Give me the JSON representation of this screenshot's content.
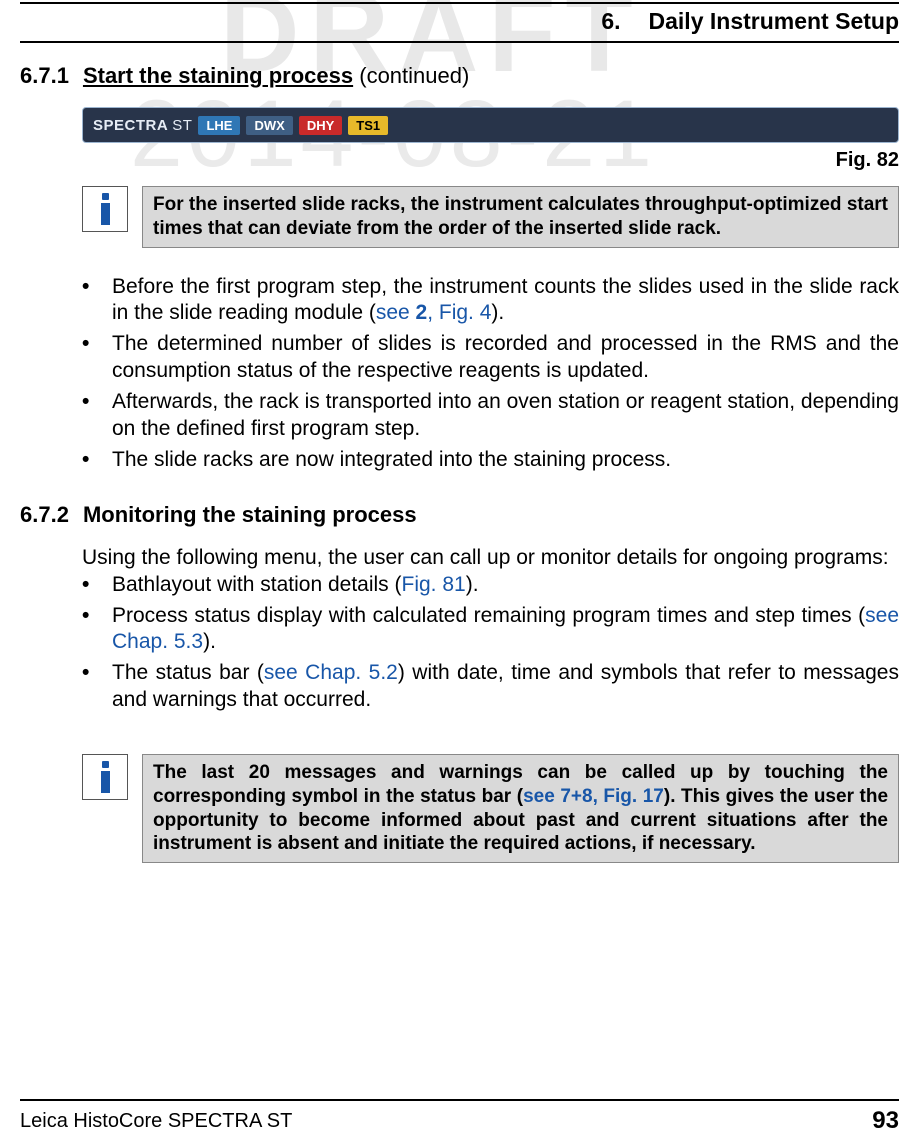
{
  "watermark": {
    "draft": "DRAFT",
    "date": "2014-08-21"
  },
  "chapter": {
    "number": "6.",
    "title": "Daily Instrument Setup"
  },
  "sec671": {
    "num": "6.7.1",
    "title": "Start the staining process",
    "suffix": " (continued)",
    "statusbar": {
      "brand_a": "SPECTRA",
      "brand_b": "ST",
      "tags": {
        "lhe": "LHE",
        "dwx": "DWX",
        "dhy": "DHY",
        "ts1": "TS1"
      }
    },
    "fig": "Fig. 82",
    "info": "For the inserted slide racks, the instrument calculates throughput-optimized start times that can deviate from the order of the inserted slide rack.",
    "bullets": {
      "b1a": "Before the first program step, the instrument counts the slides used in the slide rack in the slide reading module (",
      "b1_link1": "see ",
      "b1_bold": "2",
      "b1_link2": ", Fig. 4",
      "b1b": ").",
      "b2": "The determined number of slides is recorded and processed in the RMS and the consumption status of the respective reagents is updated.",
      "b3": "Afterwards, the rack is transported into an oven station or reagent station, depending on the defined first program step.",
      "b4": "The slide racks are now integrated into the staining process."
    }
  },
  "sec672": {
    "num": "6.7.2",
    "title": "Monitoring the staining process",
    "intro": "Using the following menu, the user can call up or monitor details for ongoing programs:",
    "bullets": {
      "b1a": "Bathlayout with station details (",
      "b1_link": "Fig. 81",
      "b1b": ").",
      "b2a": "Process status display with calculated remaining program times and step times (",
      "b2_link": "see Chap. 5.3",
      "b2b": ").",
      "b3a": "The status bar (",
      "b3_link": "see Chap. 5.2",
      "b3b": ") with date, time and symbols that refer to messages and warnings that occurred."
    },
    "info": {
      "t1": "The last 20 messages and warnings can be called up by touching the corresponding symbol in the status bar (",
      "link1": "see ",
      "bold": "7+8",
      "link2": ", Fig. 17",
      "t2": "). This gives the user the opportunity to be­come informed about past and current situations after the instrument is absent and initi­ate the required actions, if necessary."
    }
  },
  "footer": {
    "product": "Leica HistoCore SPECTRA ST",
    "page": "93"
  }
}
